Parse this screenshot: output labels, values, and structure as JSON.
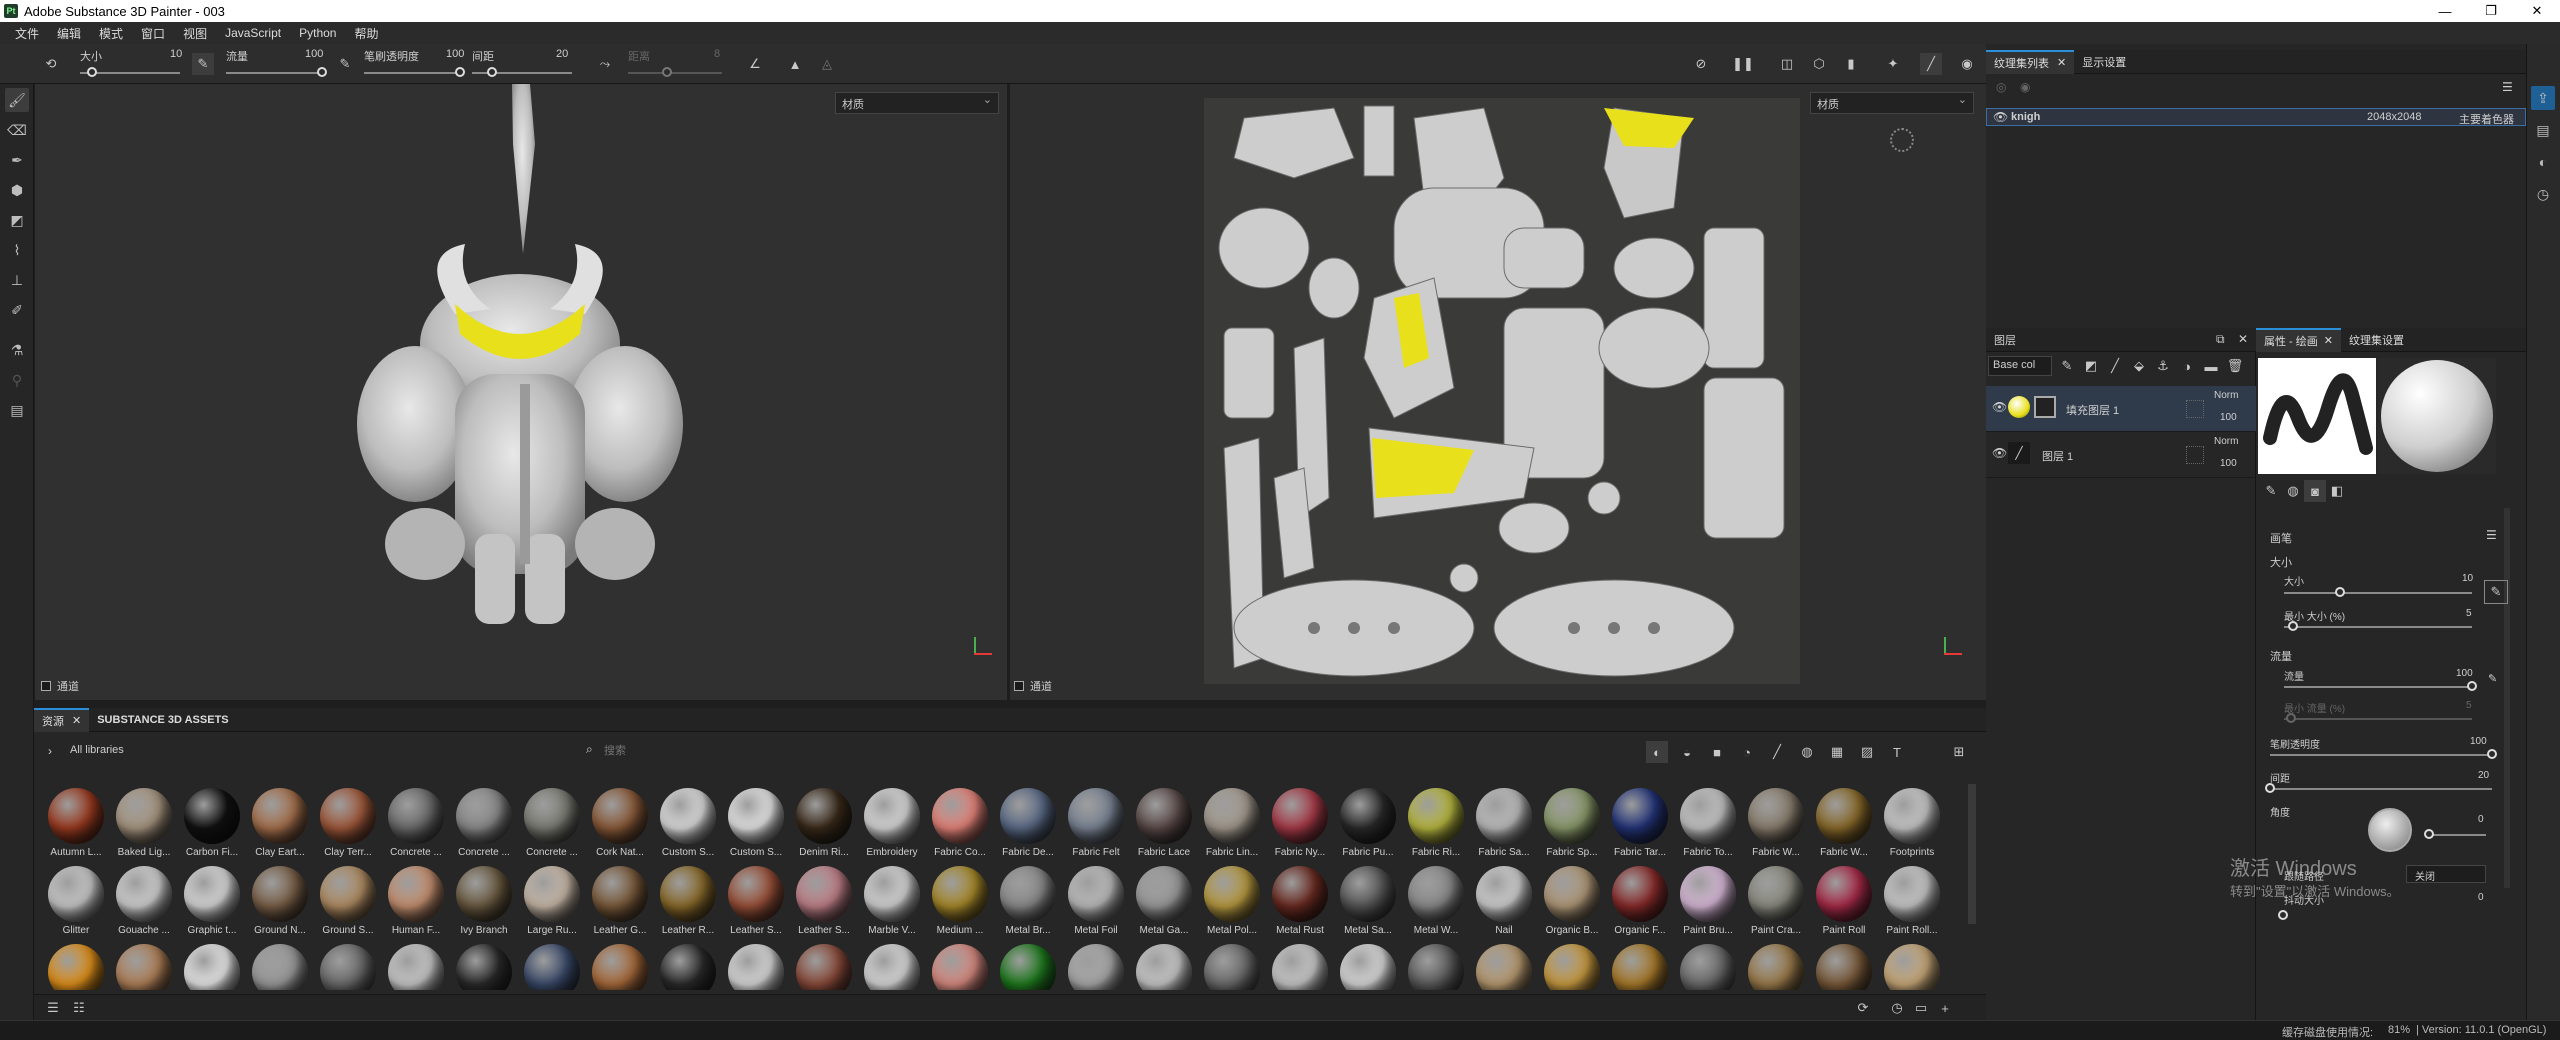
{
  "window": {
    "title": "Adobe Substance 3D Painter - 003",
    "logo": "Pt",
    "controls": [
      "—",
      "❐",
      "✕"
    ]
  },
  "menu": [
    "文件",
    "编辑",
    "模式",
    "窗口",
    "视图",
    "JavaScript",
    "Python",
    "帮助"
  ],
  "toolbar": {
    "size_label": "大小",
    "size_value": "10",
    "size_fill": 0.12,
    "flow_label": "流量",
    "flow_value": "100",
    "flow_fill": 1.0,
    "opacity_label": "笔刷透明度",
    "opacity_value": "100",
    "opacity_fill": 1.0,
    "spacing_label": "间距",
    "spacing_value": "20",
    "spacing_fill": 0.2,
    "distance_label": "距离",
    "distance_value": "8"
  },
  "viewport3d": {
    "material_select": "材质",
    "footer_label": "通道"
  },
  "viewport2d": {
    "material_select": "材质",
    "footer_label": "通道"
  },
  "texture_set_panel": {
    "tabs": [
      "纹理集列表",
      "显示设置"
    ],
    "row": {
      "name": "knigh",
      "resolution": "2048x2048",
      "shader": "主要着色器"
    }
  },
  "layers_panel": {
    "title": "图层",
    "channel_select": "Base col",
    "layers": [
      {
        "name": "填充图层 1",
        "blend": "Norm",
        "opacity": "100"
      },
      {
        "name": "图层 1",
        "blend": "Norm",
        "opacity": "100"
      }
    ]
  },
  "properties_panel": {
    "tabs": [
      "属性 - 绘画",
      "纹理集设置"
    ],
    "section": "画笔",
    "size_group": "大小",
    "size_label": "大小",
    "size_value": "10",
    "size_fill": 0.3,
    "min_size_label": "最小 大小 (%)",
    "min_size_value": "5",
    "min_size_fill": 0.05,
    "flow_group": "流量",
    "flow_label": "流量",
    "flow_value": "100",
    "flow_fill": 1.0,
    "min_flow_label": "最小 流量 (%)",
    "min_flow_value": "5",
    "opacity_label": "笔刷透明度",
    "opacity_value": "100",
    "opacity_fill": 1.0,
    "spacing_label": "间距",
    "spacing_value": "20",
    "spacing_fill": 0.0,
    "angle_label": "角度",
    "angle_value": "0",
    "follow_label": "跟随路径",
    "follow_value": "关闭",
    "jitter_label": "抖动大小",
    "jitter_value": "0",
    "watermark_line1": "激活 Windows",
    "watermark_line2": "转到\"设置\"以激活 Windows。"
  },
  "shelf": {
    "tabs": [
      "资源",
      "SUBSTANCE 3D ASSETS"
    ],
    "library": "All libraries",
    "search_placeholder": "搜索",
    "row1": [
      {
        "label": "Autumn L...",
        "color": "#9b3a1f"
      },
      {
        "label": "Baked Lig...",
        "color": "#a89680"
      },
      {
        "label": "Carbon Fi...",
        "color": "#111111"
      },
      {
        "label": "Clay Eart...",
        "color": "#a6704c"
      },
      {
        "label": "Clay Terr...",
        "color": "#a0583a"
      },
      {
        "label": "Concrete ...",
        "color": "#6b6b6b"
      },
      {
        "label": "Concrete ...",
        "color": "#8a8a8a"
      },
      {
        "label": "Concrete ...",
        "color": "#7c7c74"
      },
      {
        "label": "Cork Nat...",
        "color": "#8a5a38"
      },
      {
        "label": "Custom S...",
        "color": "#dcdcdc"
      },
      {
        "label": "Custom S...",
        "color": "#e6e6e6"
      },
      {
        "label": "Denim Ri...",
        "color": "#3a2a1a"
      },
      {
        "label": "Embroidery",
        "color": "#d8d8d8"
      },
      {
        "label": "Fabric Co...",
        "color": "#e6847a"
      },
      {
        "label": "Fabric De...",
        "color": "#5a6a86"
      },
      {
        "label": "Fabric Felt",
        "color": "#7a8494"
      },
      {
        "label": "Fabric Lace",
        "color": "#5a4a48"
      },
      {
        "label": "Fabric Lin...",
        "color": "#a39a8e"
      },
      {
        "label": "Fabric Ny...",
        "color": "#a83a48"
      },
      {
        "label": "Fabric Pu...",
        "color": "#2a2a2a"
      },
      {
        "label": "Fabric Ri...",
        "color": "#b8b840"
      },
      {
        "label": "Fabric Sa...",
        "color": "#bdbdbd"
      },
      {
        "label": "Fabric Sp...",
        "color": "#8a9a6a"
      },
      {
        "label": "Fabric Tar...",
        "color": "#23347a"
      },
      {
        "label": "Fabric To...",
        "color": "#c4c4c4"
      },
      {
        "label": "Fabric W...",
        "color": "#8a7e6e"
      },
      {
        "label": "Fabric W...",
        "color": "#8a6a2a"
      },
      {
        "label": "Footprints",
        "color": "#c8c8c8"
      }
    ],
    "row2": [
      {
        "label": "Glitter",
        "color": "#c8c8c8"
      },
      {
        "label": "Gouache ...",
        "color": "#d0d0d0"
      },
      {
        "label": "Graphic t...",
        "color": "#d8d8d8"
      },
      {
        "label": "Ground N...",
        "color": "#7a6048"
      },
      {
        "label": "Ground S...",
        "color": "#b08c62"
      },
      {
        "label": "Human F...",
        "color": "#c69070"
      },
      {
        "label": "Ivy Branch",
        "color": "#6a5a40"
      },
      {
        "label": "Large Ru...",
        "color": "#c8b8a8"
      },
      {
        "label": "Leather G...",
        "color": "#7a5a3a"
      },
      {
        "label": "Leather R...",
        "color": "#8a6a2a"
      },
      {
        "label": "Leather S...",
        "color": "#9a5038"
      },
      {
        "label": "Leather S...",
        "color": "#c08088"
      },
      {
        "label": "Marble V...",
        "color": "#d4d4d4"
      },
      {
        "label": "Medium ...",
        "color": "#a88a2a"
      },
      {
        "label": "Metal Br...",
        "color": "#8a8a8a"
      },
      {
        "label": "Metal Foil",
        "color": "#bcbcbc"
      },
      {
        "label": "Metal Ga...",
        "color": "#9a9a9a"
      },
      {
        "label": "Metal Pol...",
        "color": "#b89a40"
      },
      {
        "label": "Metal Rust",
        "color": "#6a2a20"
      },
      {
        "label": "Metal Sa...",
        "color": "#555555"
      },
      {
        "label": "Metal W...",
        "color": "#8a8a8a"
      },
      {
        "label": "Nail",
        "color": "#cfcfcf"
      },
      {
        "label": "Organic B...",
        "color": "#b09878"
      },
      {
        "label": "Organic F...",
        "color": "#8a2a2a"
      },
      {
        "label": "Paint Bru...",
        "color": "#d8b8d8"
      },
      {
        "label": "Paint Cra...",
        "color": "#8a8a80"
      },
      {
        "label": "Paint Roll",
        "color": "#a82a48"
      },
      {
        "label": "Paint Roll...",
        "color": "#c8c8c8"
      }
    ],
    "row3": [
      {
        "label": "",
        "color": "#e0901a"
      },
      {
        "label": "",
        "color": "#b08058"
      },
      {
        "label": "",
        "color": "#e8e8e8"
      },
      {
        "label": "",
        "color": "#9a9a9a"
      },
      {
        "label": "",
        "color": "#6a6a6a"
      },
      {
        "label": "",
        "color": "#c8c8c8"
      },
      {
        "label": "",
        "color": "#2a2a2a"
      },
      {
        "label": "",
        "color": "#3a4a6a"
      },
      {
        "label": "",
        "color": "#a86a3a"
      },
      {
        "label": "",
        "color": "#2a2a2a"
      },
      {
        "label": "",
        "color": "#d8d8d8"
      },
      {
        "label": "",
        "color": "#8a4a3a"
      },
      {
        "label": "",
        "color": "#d8d8d8"
      },
      {
        "label": "",
        "color": "#d88a80"
      },
      {
        "label": "",
        "color": "#1e7a1e"
      },
      {
        "label": "",
        "color": "#a8a8a8"
      },
      {
        "label": "",
        "color": "#c8c8c8"
      },
      {
        "label": "",
        "color": "#6a6a6a"
      },
      {
        "label": "",
        "color": "#c8c8c8"
      },
      {
        "label": "",
        "color": "#d8d8d8"
      },
      {
        "label": "",
        "color": "#5a5a5a"
      },
      {
        "label": "",
        "color": "#b89a70"
      },
      {
        "label": "",
        "color": "#c89a40"
      },
      {
        "label": "",
        "color": "#a87a2a"
      },
      {
        "label": "",
        "color": "#6a6a6a"
      },
      {
        "label": "",
        "color": "#9a7a4a"
      },
      {
        "label": "",
        "color": "#7a5a3a"
      },
      {
        "label": "",
        "color": "#c8a878"
      }
    ]
  },
  "status": {
    "disk": "缓存磁盘使用情况:",
    "percent": "81%",
    "version": "| Version: 11.0.1 (OpenGL)"
  },
  "colors": {
    "accent": "#2a8ed8",
    "highlight_yellow": "#e8e01a"
  }
}
